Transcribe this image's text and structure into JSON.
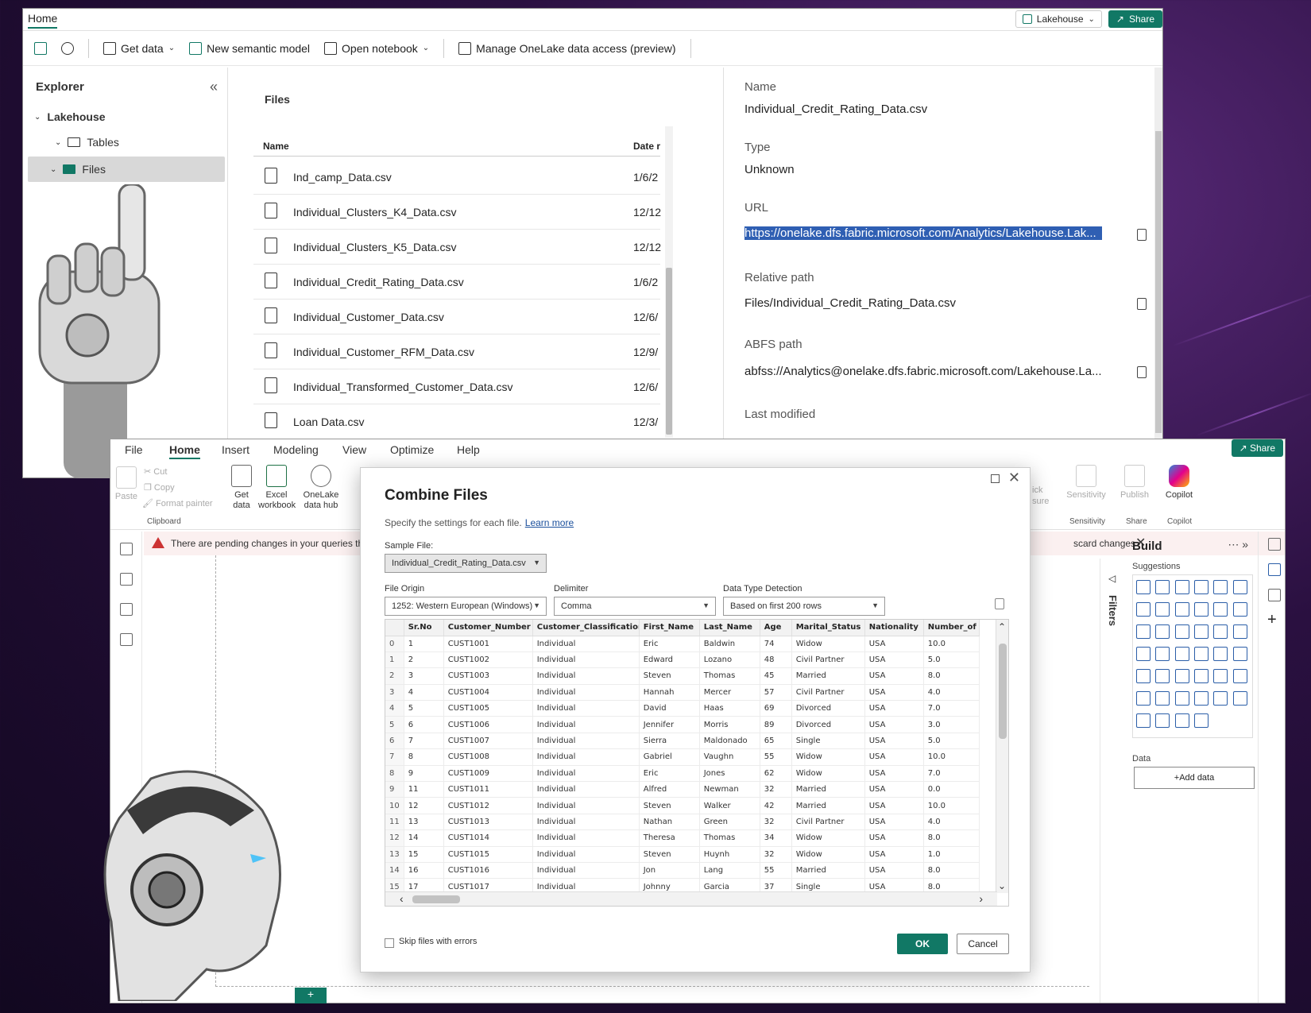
{
  "lakehouse": {
    "home_tab": "Home",
    "lakehouse_button": "Lakehouse",
    "share_button": "Share",
    "toolbar": {
      "get_data": "Get data",
      "new_semantic_model": "New semantic model",
      "open_notebook": "Open notebook",
      "manage_access": "Manage OneLake data access (preview)"
    },
    "explorer": {
      "title": "Explorer",
      "root": "Lakehouse",
      "tables": "Tables",
      "files": "Files"
    },
    "files": {
      "title": "Files",
      "col_name": "Name",
      "col_date": "Date r",
      "rows": [
        {
          "name": "Ind_camp_Data.csv",
          "date": "1/6/2"
        },
        {
          "name": "Individual_Clusters_K4_Data.csv",
          "date": "12/12"
        },
        {
          "name": "Individual_Clusters_K5_Data.csv",
          "date": "12/12"
        },
        {
          "name": "Individual_Credit_Rating_Data.csv",
          "date": "1/6/2"
        },
        {
          "name": "Individual_Customer_Data.csv",
          "date": "12/6/"
        },
        {
          "name": "Individual_Customer_RFM_Data.csv",
          "date": "12/9/"
        },
        {
          "name": "Individual_Transformed_Customer_Data.csv",
          "date": "12/6/"
        },
        {
          "name": "Loan Data.csv",
          "date": "12/3/"
        }
      ]
    },
    "properties": {
      "name_label": "Name",
      "name_value": "Individual_Credit_Rating_Data.csv",
      "type_label": "Type",
      "type_value": "Unknown",
      "url_label": "URL",
      "url_value": "https://onelake.dfs.fabric.microsoft.com/Analytics/Lakehouse.Lak...",
      "relpath_label": "Relative path",
      "relpath_value": "Files/Individual_Credit_Rating_Data.csv",
      "abfs_label": "ABFS path",
      "abfs_value": "abfss://Analytics@onelake.dfs.fabric.microsoft.com/Lakehouse.La...",
      "modified_label": "Last modified"
    }
  },
  "pbi": {
    "menu": [
      "File",
      "Home",
      "Insert",
      "Modeling",
      "View",
      "Optimize",
      "Help"
    ],
    "share": "Share",
    "ribbon": {
      "paste": "Paste",
      "cut": "Cut",
      "copy": "Copy",
      "format_painter": "Format painter",
      "clipboard": "Clipboard",
      "get_data": "Get data",
      "excel": "Excel workbook",
      "onelake": "OneLake data hub",
      "sensitivity": "Sensitivity",
      "publish": "Publish",
      "copilot": "Copilot",
      "group_sensitivity": "Sensitivity",
      "group_share": "Share",
      "group_copilot": "Copilot",
      "quick": "ick",
      "measure": "sure"
    },
    "warning": "There are pending changes in your queries that",
    "discard": "scard changes",
    "filters": "Filters",
    "build": {
      "title": "Build",
      "suggestions": "Suggestions",
      "data": "Data",
      "add_data": "+Add data"
    },
    "page_add": "+"
  },
  "dialog": {
    "title": "Combine Files",
    "subtitle": "Specify the settings for each file.",
    "learn_more": "Learn more",
    "sample_label": "Sample File:",
    "sample_value": "Individual_Credit_Rating_Data.csv",
    "origin_label": "File Origin",
    "origin_value": "1252: Western European (Windows)",
    "delimiter_label": "Delimiter",
    "delimiter_value": "Comma",
    "detection_label": "Data Type Detection",
    "detection_value": "Based on first 200 rows",
    "columns": [
      "",
      "Sr.No",
      "Customer_Number",
      "Customer_Classification",
      "First_Name",
      "Last_Name",
      "Age",
      "Marital_Status",
      "Nationality",
      "Number_of"
    ],
    "rows": [
      [
        "0",
        "1",
        "CUST1001",
        "Individual",
        "Eric",
        "Baldwin",
        "74",
        "Widow",
        "USA",
        "10.0"
      ],
      [
        "1",
        "2",
        "CUST1002",
        "Individual",
        "Edward",
        "Lozano",
        "48",
        "Civil Partner",
        "USA",
        "5.0"
      ],
      [
        "2",
        "3",
        "CUST1003",
        "Individual",
        "Steven",
        "Thomas",
        "45",
        "Married",
        "USA",
        "8.0"
      ],
      [
        "3",
        "4",
        "CUST1004",
        "Individual",
        "Hannah",
        "Mercer",
        "57",
        "Civil Partner",
        "USA",
        "4.0"
      ],
      [
        "4",
        "5",
        "CUST1005",
        "Individual",
        "David",
        "Haas",
        "69",
        "Divorced",
        "USA",
        "7.0"
      ],
      [
        "5",
        "6",
        "CUST1006",
        "Individual",
        "Jennifer",
        "Morris",
        "89",
        "Divorced",
        "USA",
        "3.0"
      ],
      [
        "6",
        "7",
        "CUST1007",
        "Individual",
        "Sierra",
        "Maldonado",
        "65",
        "Single",
        "USA",
        "5.0"
      ],
      [
        "7",
        "8",
        "CUST1008",
        "Individual",
        "Gabriel",
        "Vaughn",
        "55",
        "Widow",
        "USA",
        "10.0"
      ],
      [
        "8",
        "9",
        "CUST1009",
        "Individual",
        "Eric",
        "Jones",
        "62",
        "Widow",
        "USA",
        "7.0"
      ],
      [
        "9",
        "11",
        "CUST1011",
        "Individual",
        "Alfred",
        "Newman",
        "32",
        "Married",
        "USA",
        "0.0"
      ],
      [
        "10",
        "12",
        "CUST1012",
        "Individual",
        "Steven",
        "Walker",
        "42",
        "Married",
        "USA",
        "10.0"
      ],
      [
        "11",
        "13",
        "CUST1013",
        "Individual",
        "Nathan",
        "Green",
        "32",
        "Civil Partner",
        "USA",
        "4.0"
      ],
      [
        "12",
        "14",
        "CUST1014",
        "Individual",
        "Theresa",
        "Thomas",
        "34",
        "Widow",
        "USA",
        "8.0"
      ],
      [
        "13",
        "15",
        "CUST1015",
        "Individual",
        "Steven",
        "Huynh",
        "32",
        "Widow",
        "USA",
        "1.0"
      ],
      [
        "14",
        "16",
        "CUST1016",
        "Individual",
        "Jon",
        "Lang",
        "55",
        "Married",
        "USA",
        "8.0"
      ],
      [
        "15",
        "17",
        "CUST1017",
        "Individual",
        "Johnny",
        "Garcia",
        "37",
        "Single",
        "USA",
        "8.0"
      ]
    ],
    "skip_label": "Skip files with errors",
    "ok": "OK",
    "cancel": "Cancel"
  },
  "colors": {
    "accent": "#117865",
    "selection": "#2f5fb3",
    "warning": "#cc3333"
  }
}
